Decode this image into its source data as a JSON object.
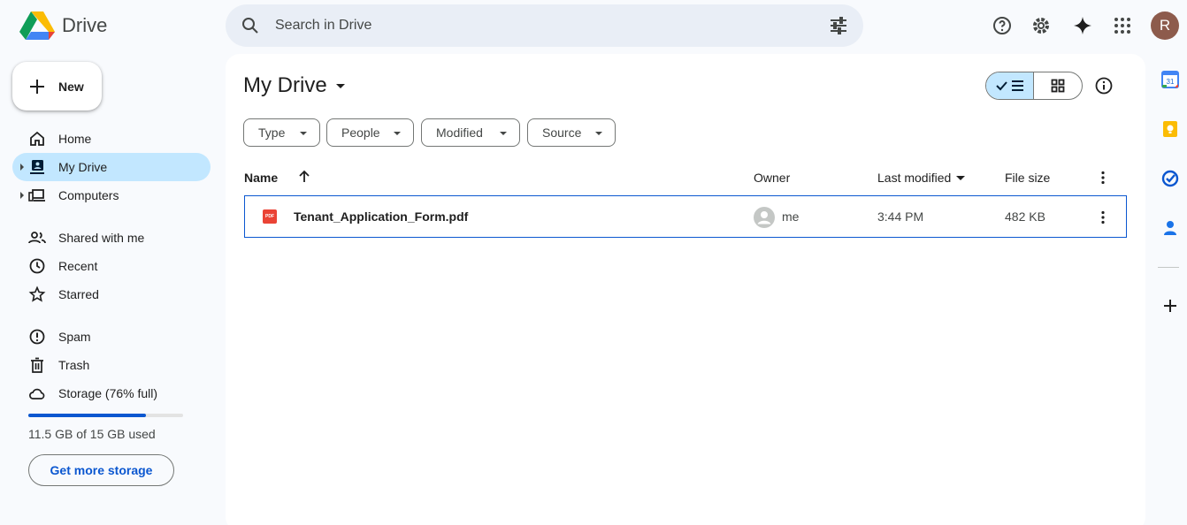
{
  "app": {
    "name": "Drive"
  },
  "search": {
    "placeholder": "Search in Drive"
  },
  "user": {
    "initial": "R"
  },
  "nav": {
    "new_label": "New",
    "items": [
      {
        "label": "Home",
        "icon": "home-icon"
      },
      {
        "label": "My Drive",
        "icon": "my-drive-icon",
        "active": true
      },
      {
        "label": "Computers",
        "icon": "computer-icon"
      },
      {
        "label": "Shared with me",
        "icon": "people-icon"
      },
      {
        "label": "Recent",
        "icon": "clock-icon"
      },
      {
        "label": "Starred",
        "icon": "star-icon"
      },
      {
        "label": "Spam",
        "icon": "spam-icon"
      },
      {
        "label": "Trash",
        "icon": "trash-icon"
      },
      {
        "label": "Storage (76% full)",
        "icon": "cloud-icon"
      }
    ],
    "storage_used_fraction": 0.76,
    "storage_text": "11.5 GB of 15 GB used",
    "get_storage_label": "Get more storage"
  },
  "main": {
    "title": "My Drive",
    "filters": [
      "Type",
      "People",
      "Modified",
      "Source"
    ],
    "columns": {
      "name": "Name",
      "owner": "Owner",
      "modified": "Last modified",
      "size": "File size"
    },
    "files": [
      {
        "name": "Tenant_Application_Form.pdf",
        "type_badge": "PDF",
        "owner": "me",
        "modified": "3:44 PM",
        "size": "482 KB"
      }
    ]
  },
  "rail": {
    "calendar_day": "31"
  },
  "colors": {
    "accent": "#0b57d0",
    "active_bg": "#c2e7ff",
    "search_bg": "#e9eef6",
    "page_bg": "#f8fafd"
  }
}
